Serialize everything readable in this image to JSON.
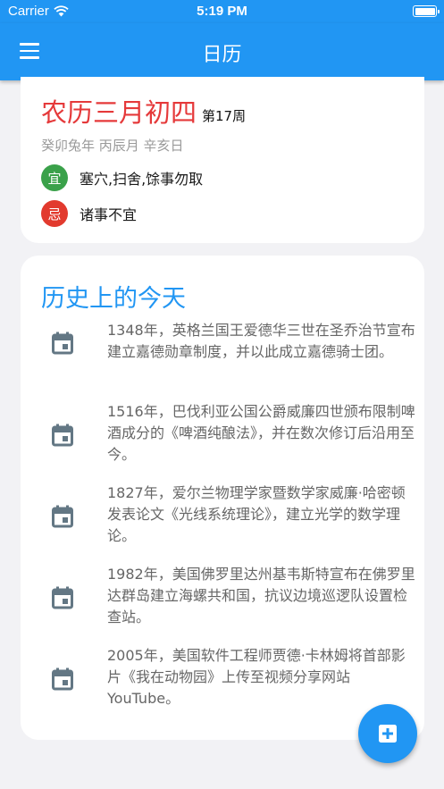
{
  "status_bar": {
    "carrier": "Carrier",
    "time": "5:19 PM",
    "wifi_icon": "wifi-icon",
    "battery_icon": "battery-icon"
  },
  "app_bar": {
    "title": "日历",
    "menu_icon": "menu-icon",
    "color": "#2196f3"
  },
  "lunar": {
    "date": "农历三月初四",
    "week": "第17周",
    "ganzhi": "癸卯兔年 丙辰月 辛亥日",
    "yi": {
      "badge": "宜",
      "text": "塞穴,扫舍,馀事勿取",
      "color": "#3aa14a"
    },
    "ji": {
      "badge": "忌",
      "text": "诸事不宜",
      "color": "#e23a2e"
    },
    "date_color": "#e5393a"
  },
  "history": {
    "title": "历史上的今天",
    "event_icon": "calendar-icon",
    "events": [
      {
        "text": "1348年，英格兰国王爱德华三世在圣乔治节宣布建立嘉德勋章制度，并以此成立嘉德骑士团。"
      },
      {
        "text": "1516年，巴伐利亚公国公爵威廉四世颁布限制啤酒成分的《啤酒纯酿法》，并在数次修订后沿用至今。"
      },
      {
        "text": "1827年，爱尔兰物理学家暨数学家威廉·哈密顿发表论文《光线系统理论》，建立光学的数学理论。"
      },
      {
        "text": "1982年，美国佛罗里达州基韦斯特宣布在佛罗里达群岛建立海螺共和国，抗议边境巡逻队设置检查站。"
      },
      {
        "text": "2005年，美国软件工程师贾德·卡林姆将首部影片《我在动物园》上传至视频分享网站YouTube。"
      }
    ]
  },
  "fab": {
    "icon": "add-box-icon"
  }
}
